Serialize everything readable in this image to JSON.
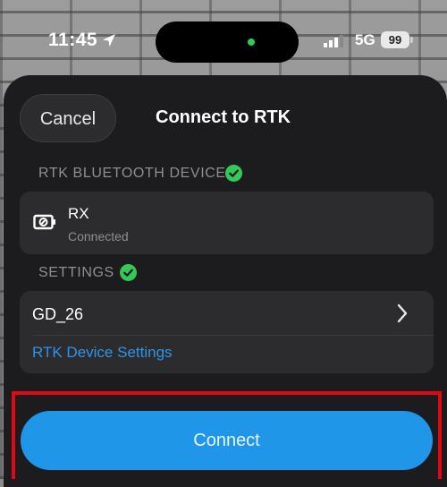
{
  "status_bar": {
    "time": "11:45",
    "network": "5G",
    "battery": "99"
  },
  "sheet": {
    "title": "Connect to RTK",
    "cancel_label": "Cancel"
  },
  "bluetooth_section": {
    "header": "RTK BLUETOOTH DEVICE",
    "device_name": "RX",
    "device_status": "Connected",
    "verified_icon": "check-circle-icon"
  },
  "settings_section": {
    "header": "SETTINGS",
    "value": "GD_26",
    "link_label": "RTK Device Settings",
    "verified_icon": "check-circle-icon"
  },
  "connect_label": "Connect",
  "colors": {
    "accent": "#1f96e8",
    "link": "#2f93e8",
    "success": "#34c759",
    "highlight": "#e30613",
    "sheet_bg": "#1c1c1e",
    "card_bg": "#2c2c2e"
  }
}
